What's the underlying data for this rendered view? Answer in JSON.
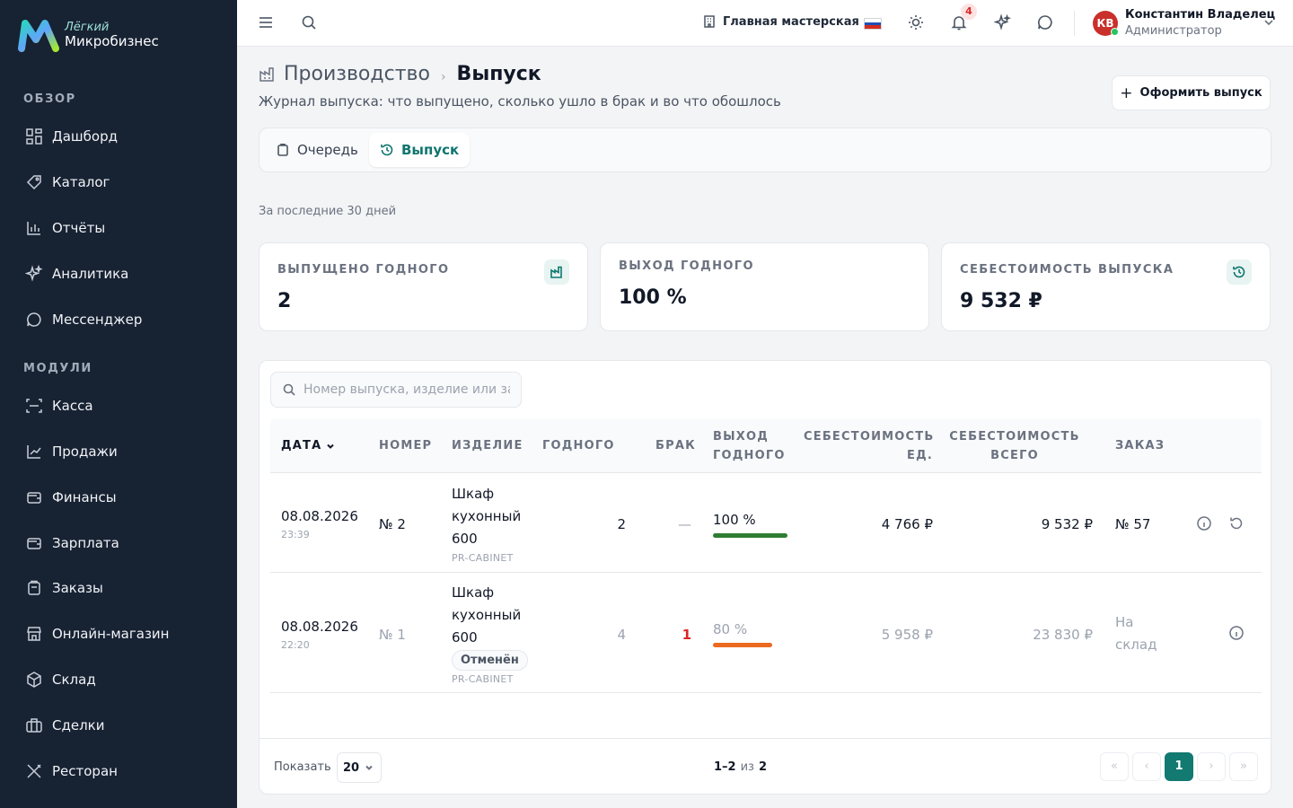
{
  "brand": {
    "small": "Лёгкий",
    "big": "Микробизнес"
  },
  "sidebar": {
    "section_overview": "ОБЗОР",
    "section_modules": "МОДУЛИ",
    "items": [
      {
        "label": "Дашборд",
        "icon": "dashboard-icon"
      },
      {
        "label": "Каталог",
        "icon": "catalog-icon"
      },
      {
        "label": "Отчёты",
        "icon": "reports-icon"
      },
      {
        "label": "Аналитика",
        "icon": "sparkle-icon"
      },
      {
        "label": "Мессенджер",
        "icon": "chat-icon"
      },
      {
        "label": "Касса",
        "icon": "scan-icon"
      },
      {
        "label": "Продажи",
        "icon": "chart-line-icon"
      },
      {
        "label": "Финансы",
        "icon": "wallet-icon"
      },
      {
        "label": "Зарплата",
        "icon": "wallet-icon"
      },
      {
        "label": "Заказы",
        "icon": "clipboard-icon"
      },
      {
        "label": "Онлайн-магазин",
        "icon": "store-icon"
      },
      {
        "label": "Склад",
        "icon": "box-icon"
      },
      {
        "label": "Сделки",
        "icon": "briefcase-icon"
      },
      {
        "label": "Ресторан",
        "icon": "utensils-icon"
      }
    ]
  },
  "topbar": {
    "workshop": "Главная мастерская",
    "notifications_count": "4",
    "user_initials": "КВ",
    "user_name": "Константин Владелец",
    "user_role": "Администратор"
  },
  "header": {
    "parent": "Производство",
    "separator": "›",
    "current": "Выпуск",
    "subtitle": "Журнал выпуска: что выпущено, сколько ушло в брак и во что обошлось",
    "primary_button": "Оформить выпуск"
  },
  "tabs": [
    {
      "label": "Очередь"
    },
    {
      "label": "Выпуск"
    }
  ],
  "period": "За последние 30 дней",
  "kpis": [
    {
      "label": "ВЫПУЩЕНО ГОДНОГО",
      "value": "2",
      "icon": "factory-icon"
    },
    {
      "label": "ВЫХОД ГОДНОГО",
      "value": "100 %"
    },
    {
      "label": "СЕБЕСТОИМОСТЬ ВЫПУСКА",
      "value": "9 532 ₽",
      "icon": "history-icon"
    }
  ],
  "search": {
    "placeholder": "Номер выпуска, изделие или заказ"
  },
  "columns": {
    "date": "ДАТА",
    "number": "НОМЕР",
    "product": "ИЗДЕЛИЕ",
    "good": "ГОДНОГО",
    "defect": "БРАК",
    "yield_1": "ВЫХОД",
    "yield_2": "ГОДНОГО",
    "unit_cost_1": "СЕБЕСТОИМОСТЬ",
    "unit_cost_2": "ЕД.",
    "total_cost_1": "СЕБЕСТОИМОСТЬ",
    "total_cost_2": "ВСЕГО",
    "order": "ЗАКАЗ"
  },
  "rows": [
    {
      "date": "08.08.2026",
      "time": "23:39",
      "number": "№ 2",
      "product_l1": "Шкаф",
      "product_l2": "кухонный",
      "product_l3": "600",
      "sku": "PR-CABINET",
      "good": "2",
      "defect": "—",
      "yield": "100 %",
      "yield_value": 1.0,
      "yield_color": "#2e7d32",
      "unit_cost": "4 766 ₽",
      "total_cost": "9 532 ₽",
      "order": "№ 57"
    },
    {
      "date": "08.08.2026",
      "time": "22:20",
      "number": "№ 1",
      "product_l1": "Шкаф",
      "product_l2": "кухонный",
      "product_l3": "600",
      "status": "Отменён",
      "sku": "PR-CABINET",
      "good": "4",
      "defect": "1",
      "yield": "80 %",
      "yield_value": 0.8,
      "yield_color": "#ea6a1f",
      "unit_cost": "5 958 ₽",
      "total_cost": "23 830 ₽",
      "order_l1": "На",
      "order_l2": "склад"
    }
  ],
  "footer": {
    "show_label": "Показать",
    "page_size": "20",
    "range": "1–2",
    "of": "из",
    "total": "2",
    "current_page": "1",
    "first": "«",
    "prev": "‹",
    "next": "›",
    "last": "»"
  },
  "colors": {
    "sidebar_bg": "#172233",
    "accent": "#137a72",
    "danger": "#dc2626"
  }
}
